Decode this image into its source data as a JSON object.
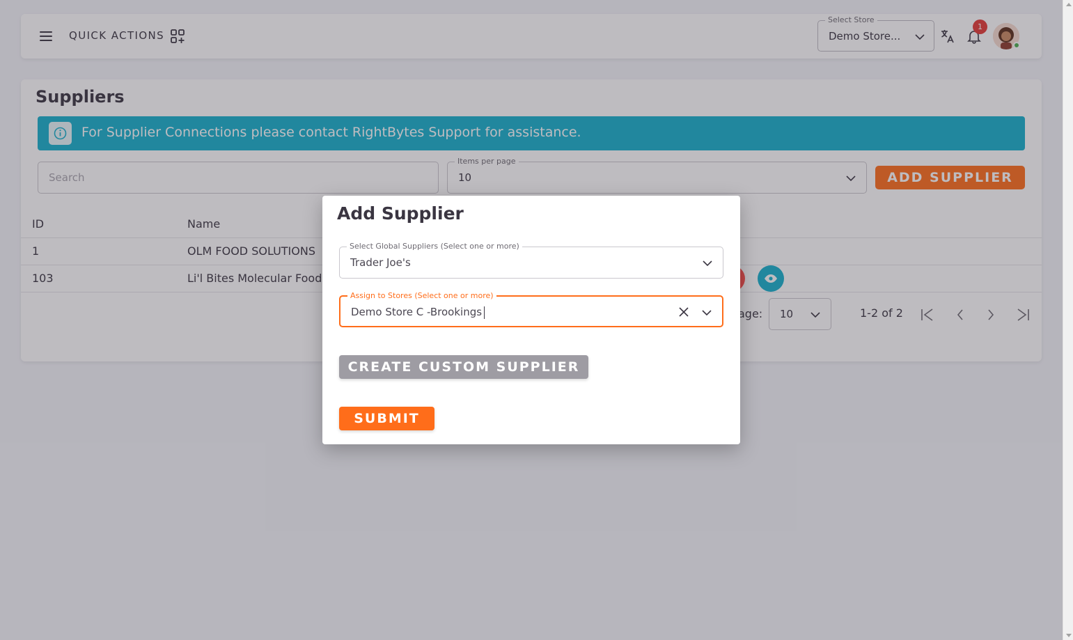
{
  "header": {
    "quick_actions": "QUICK ACTIONS",
    "store_select_legend": "Select Store",
    "store_select_value": "Demo Store...",
    "notification_count": "1"
  },
  "page": {
    "title": "Suppliers",
    "alert_text": "For Supplier Connections please contact RightBytes Support for assistance.",
    "search_placeholder": "Search",
    "items_per_page_legend": "Items per page",
    "items_per_page_value": "10",
    "add_supplier_label": "ADD SUPPLIER"
  },
  "table": {
    "columns": [
      "ID",
      "Name"
    ],
    "rows": [
      {
        "id": "1",
        "name": "OLM FOOD SOLUTIONS"
      },
      {
        "id": "103",
        "name": "Li'l Bites Molecular Food"
      }
    ]
  },
  "pagination": {
    "rows_label": "age:",
    "rows_value": "10",
    "range": "1-2 of 2"
  },
  "modal": {
    "title": "Add Supplier",
    "global_legend": "Select Global Suppliers (Select one or more)",
    "global_value": "Trader Joe's",
    "stores_legend": "Assign to Stores (Select one or more)",
    "stores_value": "Demo Store C -Brookings",
    "custom_label": "CREATE CUSTOM SUPPLIER",
    "submit_label": "SUBMIT"
  },
  "colors": {
    "accent": "#ff6d1a",
    "info": "#16b1cd",
    "danger": "#ff4d49"
  }
}
